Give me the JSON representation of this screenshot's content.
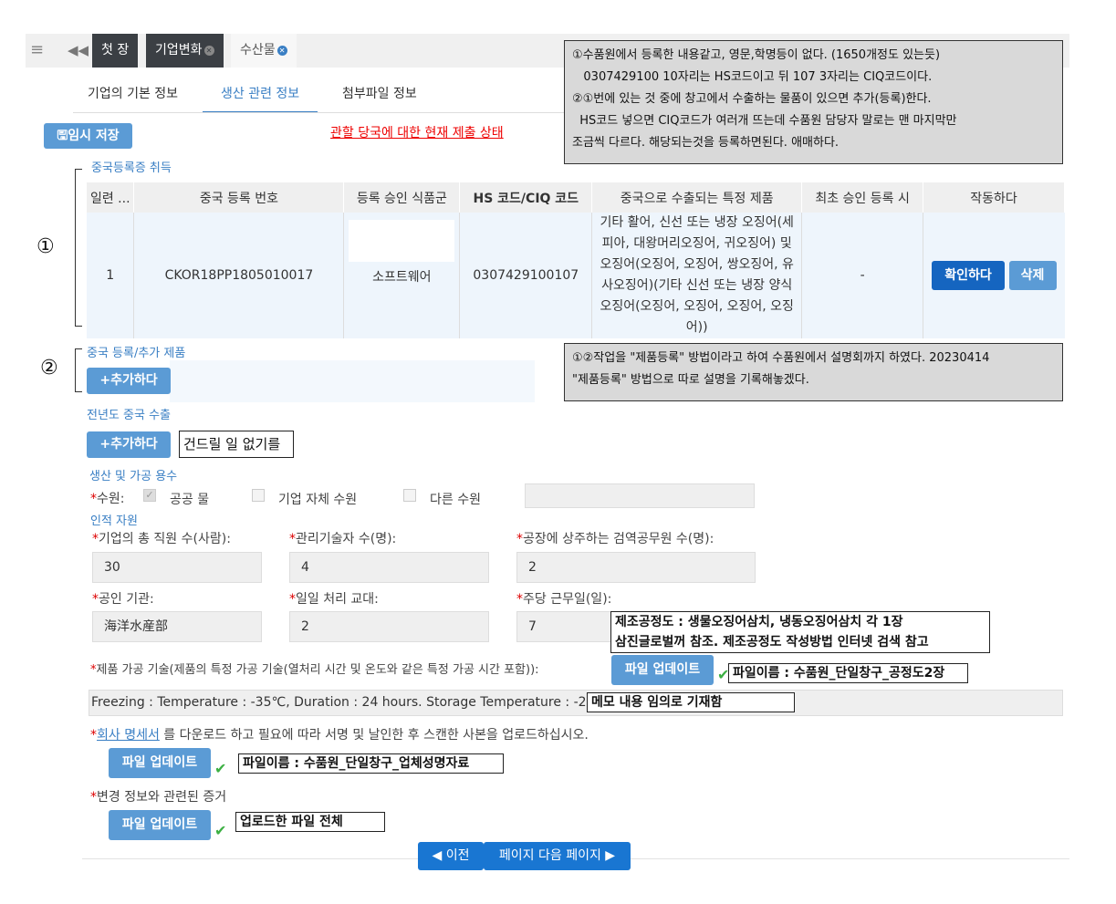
{
  "tabs": {
    "first": "첫 장",
    "company_change": "기업변화",
    "seafood": "수산물"
  },
  "subtabs": [
    "기업의 기본 정보",
    "생산 관련 정보",
    "첨부파일 정보"
  ],
  "temp_save": "임시 저장",
  "submission_status": "관할 당국에 대한 현재 제출 상태",
  "notes": {
    "top_lines": [
      "①수품원에서 등록한 내용같고, 영문,학명등이 없다. (1650개정도 있는듯)",
      "   0307429100 10자리는 HS코드이고 뒤 107 3자리는 CIQ코드이다.",
      "②①번에 있는 것 중에 창고에서 수출하는 물품이 있으면 추가(등록)한다.",
      "  HS코드 넣으면 CIQ코드가 여러개 뜨는데 수품원 담당자 말로는 맨 마지막만",
      "조금씩 다르다. 해당되는것을 등록하면된다. 애매하다."
    ],
    "second_lines": [
      "①②작업을 \"제품등록\" 방법이라고 하여 수품원에서 설명회까지 하였다. 20230414",
      "\"제품등록\" 방법으로 따로 설명을 기록해놓겠다."
    ],
    "no_dry": "건드릴 일 없기를",
    "process_diagram": "제조공정도 : 생물오징어삼치, 냉동오징어삼치 각 1장",
    "process_diagram2": "삼진글로벌꺼 참조. 제조공정도 작성방법 인터넷 검색 참고",
    "file_name1": "파일이름 : 수품원_단일창구_공정도2장",
    "memo": "메모 내용 임의로 기재함",
    "file_name2": "파일이름 : 수품원_단일창구_업체성명자료",
    "uploaded_all": "업로드한 파일 전체"
  },
  "markers": {
    "one": "①",
    "two": "②"
  },
  "china_reg": {
    "title": "중국등록증 취득",
    "columns": [
      "일련 ...",
      "중국 등록 번호",
      "등록 승인 식품군",
      "HS 코드/CIQ 코드",
      "중국으로 수출되는 특정 제품",
      "최초 승인 등록 시",
      "작동하다"
    ],
    "row": {
      "serial": "1",
      "reg_no": "CKOR18PP1805010017",
      "food_group": "소프트웨어",
      "hs_code": "0307429100107",
      "product": "기타 활어, 신선 또는 냉장 오징어(세피아, 대왕머리오징어, 귀오징어) 및 오징어(오징어, 오징어, 쌍오징어, 유사오징어)(기타 신선 또는 냉장 양식 오징어(오징어, 오징어, 오징어, 오징어))",
      "first_date": "-",
      "confirm": "확인하다",
      "delete": "삭제"
    }
  },
  "china_add": {
    "title": "중국 등록/추가 제품",
    "add": "추가하다"
  },
  "prev_year": {
    "title": "전년도 중국 수출",
    "add": "추가하다"
  },
  "water": {
    "title": "생산 및 가공 용수",
    "label": "수원:",
    "public": "공공 물",
    "self": "기업 자체 수원",
    "other": "다른 수원"
  },
  "human": {
    "title": "인적 자원",
    "total_staff_label": "기업의 총 직원 수(사람):",
    "total_staff": "30",
    "tech_label": "관리기술자 수(명):",
    "tech": "4",
    "inspector_label": "공장에 상주하는 검역공무원 수(명):",
    "inspector": "2",
    "agency_label": "공인 기관:",
    "agency": "海洋水産部",
    "shift_label": "일일 처리 교대:",
    "shift": "2",
    "workdays_label": "주당 근무일(일):",
    "workdays": "7"
  },
  "tech_desc": {
    "label": "제품 가공 기술(제품의 특정 가공 기술(열처리 시간 및 온도와 같은 특정 가공 시간 포함)):",
    "upload": "파일 업데이트",
    "value": "Freezing : Temperature : -35℃, Duration : 24 hours. Storage Temperature : -22℃"
  },
  "declaration": {
    "prefix": "",
    "link": "회사 명세서",
    "suffix": " 를 다운로드 하고 필요에 따라 서명 및 날인한 후 스캔한 사본을 업로드하십시오.",
    "upload": "파일 업데이트"
  },
  "evidence": {
    "label": "변경 정보와 관련된 증거",
    "upload": "파일 업데이트"
  },
  "nav": {
    "prev": "이전",
    "next": "페이지 다음 페이지"
  },
  "colors": {
    "accent": "#3a7fc4",
    "button": "#5b9bd5",
    "primary": "#1565c0",
    "required": "#dd0000"
  }
}
